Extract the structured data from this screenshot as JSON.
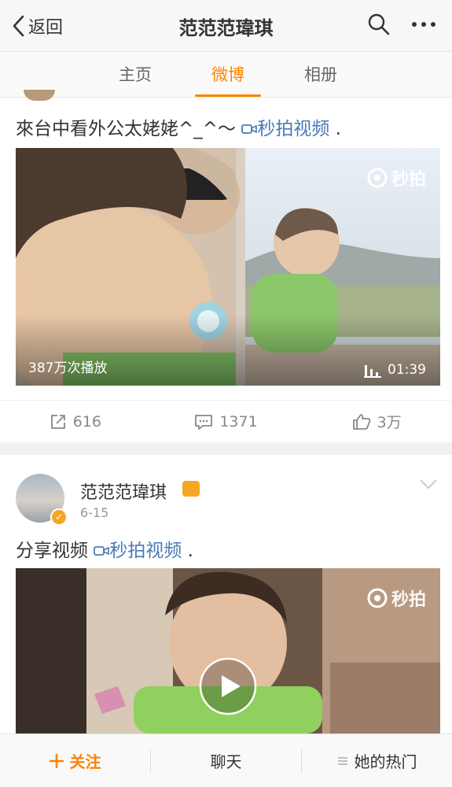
{
  "header": {
    "back_label": "返回",
    "title": "范范范瑋琪"
  },
  "tabs": [
    {
      "label": "主页"
    },
    {
      "label": "微博"
    },
    {
      "label": "相册"
    }
  ],
  "post1": {
    "text": "來台中看外公太姥姥^_^～",
    "video_link": "秒拍视频",
    "trail": ".",
    "video": {
      "watermark": "秒拍",
      "play_count": "387万次播放",
      "duration": "01:39"
    },
    "actions": {
      "repost": "616",
      "comment": "1371",
      "like": "3万"
    }
  },
  "post2": {
    "user": "范范范瑋琪",
    "date": "6-15",
    "text": "分享视频",
    "video_link": "秒拍视频",
    "trail": ".",
    "video": {
      "watermark": "秒拍"
    }
  },
  "bottom_bar": {
    "follow": "关注",
    "chat": "聊天",
    "hot": "她的热门"
  },
  "colors": {
    "accent": "#ff8200",
    "link": "#4a7ab8",
    "badge": "#f5a623"
  }
}
